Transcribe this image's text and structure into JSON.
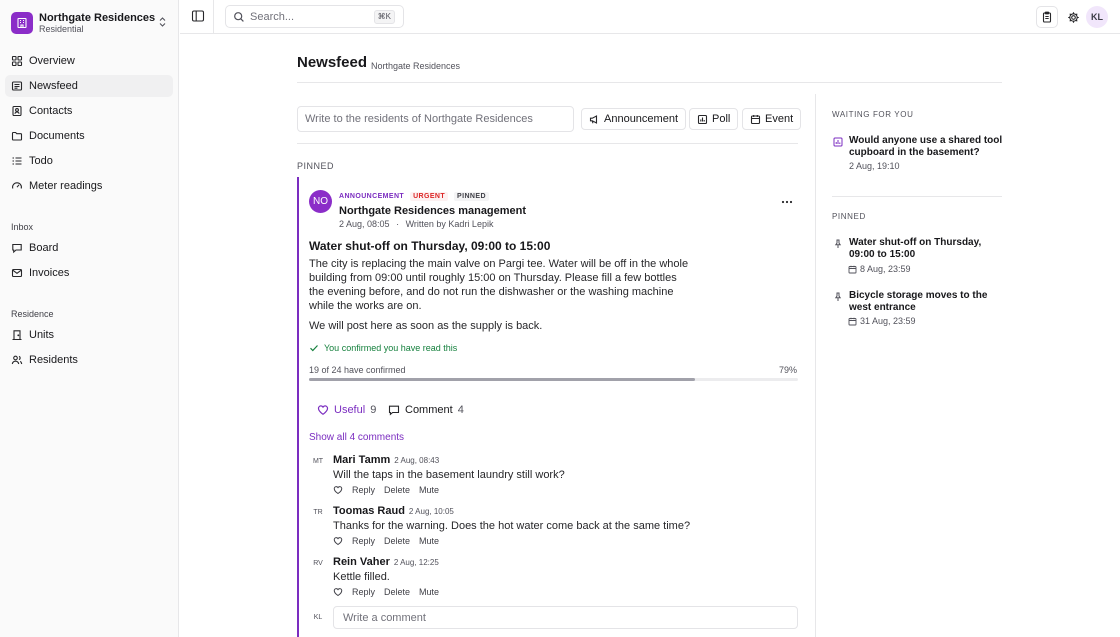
{
  "workspace": {
    "name": "Northgate Residences",
    "type": "Residential"
  },
  "sidebar": {
    "main": [
      {
        "label": "Overview",
        "icon": "grid-icon"
      },
      {
        "label": "Newsfeed",
        "icon": "newspaper-icon",
        "active": true
      },
      {
        "label": "Contacts",
        "icon": "contacts-icon"
      },
      {
        "label": "Documents",
        "icon": "folder-icon"
      },
      {
        "label": "Todo",
        "icon": "list-icon"
      },
      {
        "label": "Meter readings",
        "icon": "gauge-icon"
      }
    ],
    "inbox_label": "Inbox",
    "inbox": [
      {
        "label": "Board",
        "icon": "chat-icon"
      },
      {
        "label": "Invoices",
        "icon": "mail-icon"
      }
    ],
    "residence_label": "Residence",
    "residence": [
      {
        "label": "Units",
        "icon": "door-icon"
      },
      {
        "label": "Residents",
        "icon": "users-icon"
      }
    ]
  },
  "topbar": {
    "search_placeholder": "Search...",
    "search_shortcut": "⌘K",
    "avatar": "KL"
  },
  "header": {
    "title": "Newsfeed",
    "subtitle": "Northgate Residences"
  },
  "composer": {
    "placeholder": "Write to the residents of Northgate Residences",
    "announcement": "Announcement",
    "poll": "Poll",
    "event": "Event"
  },
  "pinned_label": "PINNED",
  "post": {
    "avatar": "NO",
    "tag_type": "ANNOUNCEMENT",
    "tag_urgent": "URGENT",
    "tag_pinned": "PINNED",
    "author": "Northgate Residences management",
    "date": "2 Aug, 08:05",
    "separator": "·",
    "written_by": "Written by Kadri Lepik",
    "title": "Water shut-off on Thursday, 09:00 to 15:00",
    "body": "The city is replacing the main valve on Pargi tee. Water will be off in the whole building from 09:00 until roughly 15:00 on Thursday. Please fill a few bottles the evening before, and do not run the dishwasher or the washing machine while the works are on.",
    "body2": "We will post here as soon as the supply is back.",
    "confirmed_text": "You confirmed you have read this",
    "progress_label": "19 of 24 have confirmed",
    "progress_pct_label": "79%",
    "progress_value": 79,
    "useful_label": "Useful",
    "useful_count": "9",
    "comment_label": "Comment",
    "comment_count": "4",
    "show_all": "Show all 4 comments",
    "comments": [
      {
        "initials": "MT",
        "name": "Mari Tamm",
        "time": "2 Aug, 08:43",
        "text": "Will the taps in the basement laundry still work?"
      },
      {
        "initials": "TR",
        "name": "Toomas Raud",
        "time": "2 Aug, 10:05",
        "text": "Thanks for the warning. Does the hot water come back at the same time?"
      },
      {
        "initials": "RV",
        "name": "Rein Vaher",
        "time": "2 Aug, 12:25",
        "text": "Kettle filled."
      }
    ],
    "comment_actions": {
      "reply": "Reply",
      "delete": "Delete",
      "mute": "Mute"
    },
    "me_initials": "KL",
    "write_comment_placeholder": "Write a comment"
  },
  "rail": {
    "waiting_label": "WAITING FOR YOU",
    "waiting": [
      {
        "title": "Would anyone use a shared tool cupboard in the basement?",
        "date": "2 Aug, 19:10"
      }
    ],
    "pinned_label": "PINNED",
    "pinned": [
      {
        "title": "Water shut-off on Thursday, 09:00 to 15:00",
        "date": "8 Aug, 23:59"
      },
      {
        "title": "Bicycle storage moves to the west entrance",
        "date": "31 Aug, 23:59"
      }
    ]
  },
  "colors": {
    "accent": "#7b2dc0",
    "brand": "#8b2dc8",
    "urgent": "#dc2626",
    "success": "#15803d"
  }
}
